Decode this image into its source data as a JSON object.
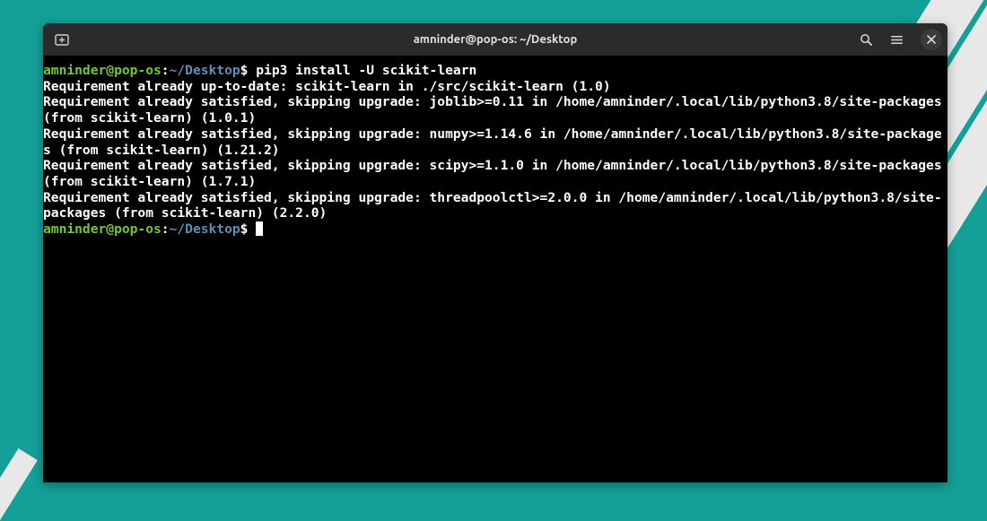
{
  "titlebar": {
    "title": "amninder@pop-os: ~/Desktop"
  },
  "prompt": {
    "user_host": "amninder@pop-os",
    "colon": ":",
    "path": "~/Desktop",
    "dollar": "$"
  },
  "cmd1": " pip3 install -U scikit-learn",
  "output": {
    "l1": "Requirement already up-to-date: scikit-learn in ./src/scikit-learn (1.0)",
    "l2": "Requirement already satisfied, skipping upgrade: joblib>=0.11 in /home/amninder/.local/lib/python3.8/site-packages (from scikit-learn) (1.0.1)",
    "l3": "Requirement already satisfied, skipping upgrade: numpy>=1.14.6 in /home/amninder/.local/lib/python3.8/site-packages (from scikit-learn) (1.21.2)",
    "l4": "Requirement already satisfied, skipping upgrade: scipy>=1.1.0 in /home/amninder/.local/lib/python3.8/site-packages (from scikit-learn) (1.7.1)",
    "l5": "Requirement already satisfied, skipping upgrade: threadpoolctl>=2.0.0 in /home/amninder/.local/lib/python3.8/site-packages (from scikit-learn) (2.2.0)"
  }
}
